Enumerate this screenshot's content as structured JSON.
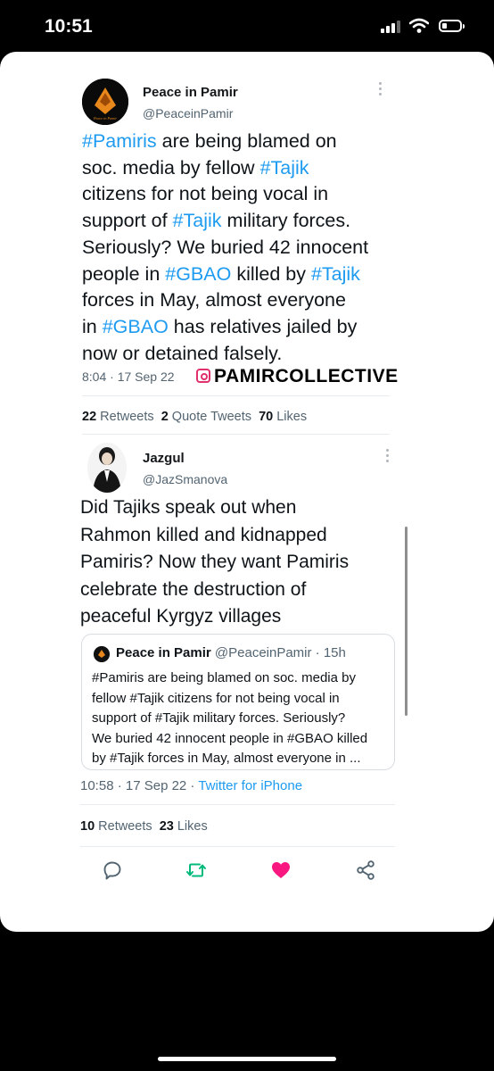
{
  "status_bar": {
    "time": "10:51"
  },
  "tweet1": {
    "author_name": "Peace in Pamir",
    "author_handle": "@PeaceinPamir",
    "avatar_caption": "Peace in Pamir",
    "text_segments": [
      {
        "t": "#Pamiris",
        "hashtag": true
      },
      {
        "t": " are being blamed on\nsoc. media by fellow ",
        "hashtag": false
      },
      {
        "t": "#Tajik",
        "hashtag": true
      },
      {
        "t": "\ncitizens for not being vocal in\nsupport of ",
        "hashtag": false
      },
      {
        "t": "#Tajik",
        "hashtag": true
      },
      {
        "t": " military forces.\nSeriously? We buried 42 innocent\npeople in ",
        "hashtag": false
      },
      {
        "t": "#GBAO",
        "hashtag": true
      },
      {
        "t": " killed by ",
        "hashtag": false
      },
      {
        "t": "#Tajik",
        "hashtag": true
      },
      {
        "t": "\nforces in May, almost everyone\nin ",
        "hashtag": false
      },
      {
        "t": "#GBAO",
        "hashtag": true
      },
      {
        "t": " has relatives jailed by\nnow or detained falsely.",
        "hashtag": false
      }
    ],
    "timestamp": "8:04 · 17 Sep 22",
    "watermark": "PAMIRCOLLECTIVE",
    "stats": {
      "retweets_count": "22",
      "retweets_label": "Retweets",
      "quotes_count": "2",
      "quotes_label": "Quote Tweets",
      "likes_count": "70",
      "likes_label": "Likes"
    }
  },
  "tweet2": {
    "author_name": "Jazgul",
    "author_handle": "@JazSmanova",
    "text": "Did Tajiks speak out when\nRahmon killed and kidnapped\nPamiris? Now they want Pamiris\ncelebrate the destruction of\npeaceful Kyrgyz villages",
    "quote": {
      "author_name": "Peace in Pamir",
      "sub": "@PeaceinPamir · 15h",
      "text": "#Pamiris are being blamed on soc. media by\nfellow #Tajik citizens for not being vocal in\nsupport of #Tajik military forces. Seriously?\nWe buried 42 innocent people in #GBAO killed\nby #Tajik forces in May, almost everyone in ..."
    },
    "timestamp": "10:58 · 17 Sep 22 · ",
    "source": "Twitter for iPhone",
    "stats": {
      "retweets_count": "10",
      "retweets_label": "Retweets",
      "likes_count": "23",
      "likes_label": "Likes"
    }
  },
  "actions": [
    {
      "icon": "reply-icon",
      "color": "#536471"
    },
    {
      "icon": "retweet-icon",
      "color": "#00ba7c"
    },
    {
      "icon": "like-icon",
      "color": "#f91880"
    },
    {
      "icon": "share-icon",
      "color": "#536471"
    }
  ],
  "colors": {
    "hashtag": "#1d9bf0",
    "secondary_text": "#536471",
    "like": "#f91880",
    "retweet": "#00ba7c"
  }
}
